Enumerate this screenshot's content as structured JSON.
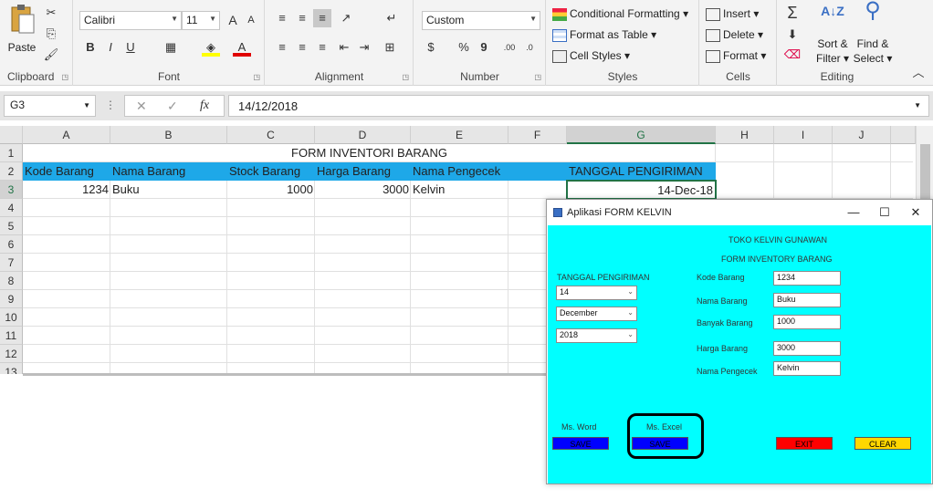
{
  "ribbon": {
    "clipboard": {
      "label": "Clipboard",
      "paste": "Paste"
    },
    "font": {
      "label": "Font",
      "name": "Calibri",
      "size": "11",
      "bold": "B",
      "italic": "I",
      "underline": "U",
      "grow": "A",
      "shrink": "A"
    },
    "alignment": {
      "label": "Alignment"
    },
    "number": {
      "label": "Number",
      "format": "Custom",
      "currency": "$",
      "percent": "%",
      "comma": "9",
      "inc": ".00",
      "dec": ".0"
    },
    "styles": {
      "label": "Styles",
      "conditional": "Conditional Formatting",
      "table": "Format as Table",
      "cell": "Cell Styles"
    },
    "cells": {
      "label": "Cells",
      "insert": "Insert",
      "delete": "Delete",
      "format": "Format"
    },
    "editing": {
      "label": "Editing",
      "sort": "Sort &",
      "sort2": "Filter",
      "find": "Find &",
      "find2": "Select",
      "sigma": "Σ"
    }
  },
  "formula_bar": {
    "name_box": "G3",
    "fx": "fx",
    "value": "14/12/2018"
  },
  "columns": [
    "A",
    "B",
    "C",
    "D",
    "E",
    "F",
    "G",
    "H",
    "I",
    "J"
  ],
  "rows": [
    "1",
    "2",
    "3",
    "4",
    "5",
    "6",
    "7",
    "8",
    "9",
    "10",
    "11",
    "12",
    "13"
  ],
  "sheet": {
    "title": "FORM INVENTORI BARANG",
    "headers": {
      "a": "Kode Barang",
      "b": "Nama Barang",
      "c": "Stock Barang",
      "d": "Harga Barang",
      "e": "Nama Pengecek",
      "g": "TANGGAL PENGIRIMAN"
    },
    "row3": {
      "a": "1234",
      "b": "Buku",
      "c": "1000",
      "d": "3000",
      "e": "Kelvin",
      "g": "14-Dec-18"
    }
  },
  "form": {
    "title": "Aplikasi FORM KELVIN",
    "heading1": "TOKO KELVIN GUNAWAN",
    "heading2": "FORM INVENTORY BARANG",
    "date_label": "TANGGAL PENGIRIMAN",
    "day": "14",
    "month": "December",
    "year": "2018",
    "fields": {
      "kode_label": "Kode Barang",
      "kode": "1234",
      "nama_label": "Nama Barang",
      "nama": "Buku",
      "banyak_label": "Banyak Barang",
      "banyak": "1000",
      "harga_label": "Harga Barang",
      "harga": "3000",
      "pengecek_label": "Nama Pengecek",
      "pengecek": "Kelvin"
    },
    "word_label": "Ms. Word",
    "excel_label": "Ms. Excel",
    "save_word": "SAVE",
    "save_excel": "SAVE",
    "exit": "EXIT",
    "clear": "CLEAR",
    "colors": {
      "body": "#00ffff",
      "save": "#0000ff",
      "exit": "#ff0000",
      "clear": "#ffd700"
    }
  }
}
